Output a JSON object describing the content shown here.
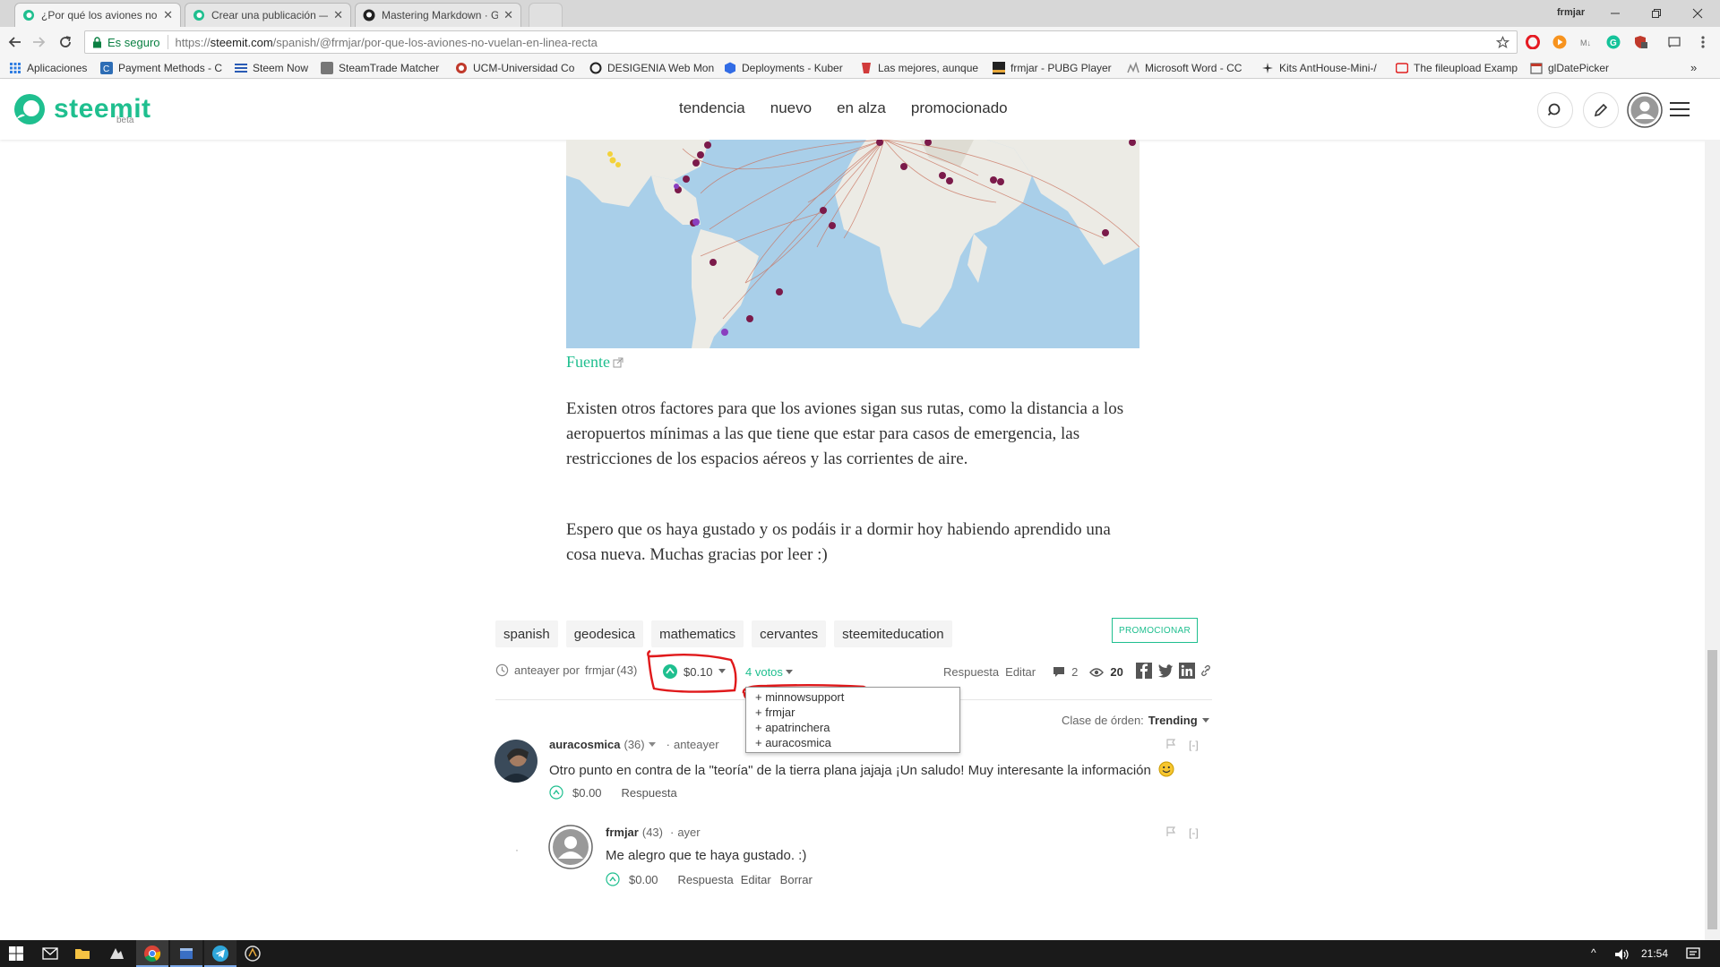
{
  "browser": {
    "tabs": [
      {
        "title": "¿Por qué los aviones no"
      },
      {
        "title": "Crear una publicación —"
      },
      {
        "title": "Mastering Markdown · G"
      }
    ],
    "profile_name": "frmjar",
    "secure_label": "Es seguro",
    "url_prefix": "https://",
    "url_host": "steemit.com",
    "url_path": "/spanish/@frmjar/por-que-los-aviones-no-vuelan-en-linea-recta",
    "bookmarks": [
      "Aplicaciones",
      "Payment Methods - C",
      "Steem Now",
      "SteamTrade Matcher",
      "UCM-Universidad Co",
      "DESIGENIA Web Mon",
      "Deployments - Kuber",
      "Las mejores, aunque",
      "frmjar - PUBG Player",
      "Microsoft Word - CC",
      "Kits AntHouse-Mini-/",
      "The fileupload Examp",
      "glDatePicker"
    ],
    "bookmarks_overflow": "»"
  },
  "site": {
    "logo": "steemit",
    "beta": "beta",
    "nav": [
      "tendencia",
      "nuevo",
      "en alza",
      "promocionado"
    ],
    "brand_color": "#1fbf8f"
  },
  "article": {
    "source_link": "Fuente",
    "paragraphs": [
      "Existen otros factores para que los aviones sigan sus rutas, como la distancia a los aeropuertos mínimas a las que tiene que estar para casos de emergencia, las restricciones de los espacios aéreos y las corrientes de aire.",
      "Espero que os haya gustado y os podáis ir a dormir hoy habiendo aprendido una cosa nueva. Muchas gracias por leer :)"
    ],
    "tags": [
      "spanish",
      "geodesica",
      "mathematics",
      "cervantes",
      "steemiteducation"
    ],
    "promote": "PROMOCIONAR",
    "posted": "anteayer por",
    "author": "frmjar",
    "author_rep": "(43)",
    "payout": "$0.10",
    "votes_label": "4 votos",
    "reply": "Respuesta",
    "edit": "Editar",
    "comment_count": "2",
    "view_count": "20",
    "voters": [
      "+ minnowsupport",
      "+ frmjar",
      "+ apatrinchera",
      "+ auracosmica"
    ]
  },
  "sort": {
    "label": "Clase de órden:",
    "value": "Trending"
  },
  "comments": [
    {
      "author": "auracosmica",
      "rep": "(36)",
      "time": "anteayer",
      "body": "Otro punto en contra de la \"teoría\" de la tierra plana jajaja ¡Un saludo! Muy interesante la información",
      "payout": "$0.00",
      "reply": "Respuesta",
      "flag_collapse": "[-]"
    },
    {
      "author": "frmjar",
      "rep": "(43)",
      "time": "ayer",
      "body": "Me alegro que te haya gustado. :)",
      "payout": "$0.00",
      "reply": "Respuesta",
      "edit": "Editar",
      "delete": "Borrar",
      "flag_collapse": "[-]"
    }
  ],
  "taskbar": {
    "clock": "21:54"
  }
}
